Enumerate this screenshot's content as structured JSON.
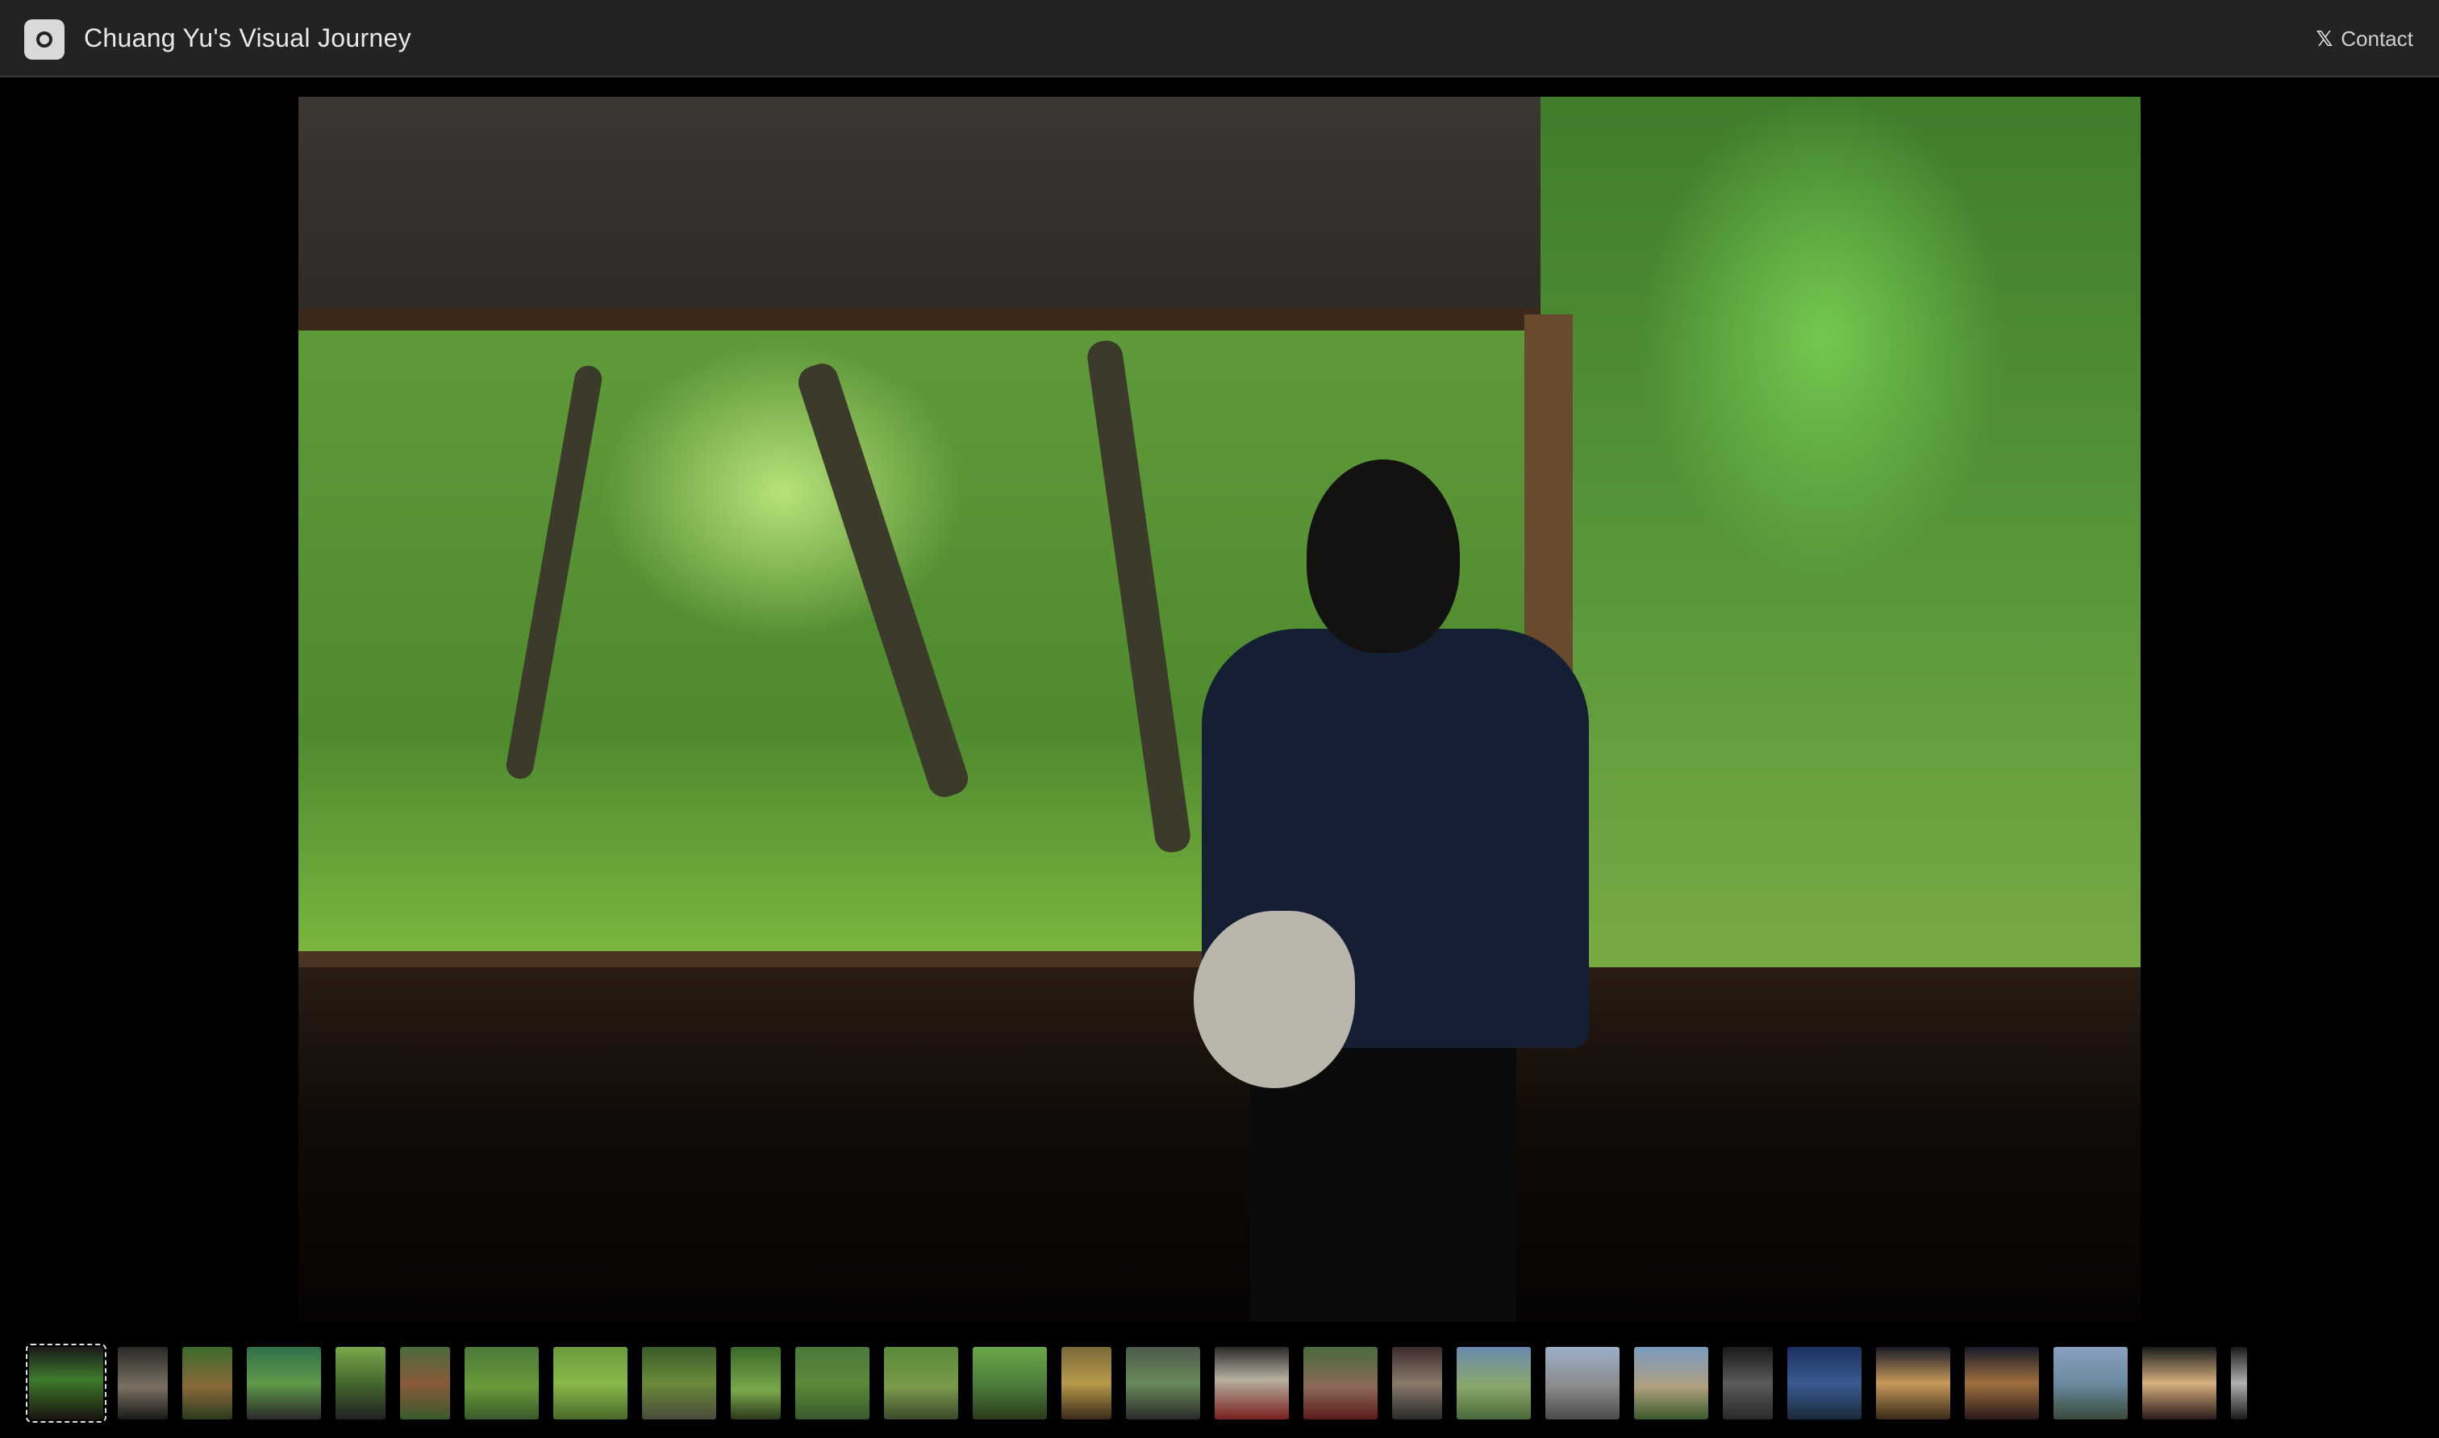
{
  "header": {
    "title": "Chuang Yu's Visual Journey",
    "contact_label": "Contact",
    "contact_icon": "x-logo-icon"
  },
  "viewer": {
    "photo_subject": "main-photo"
  },
  "filmstrip": {
    "active_index": 0,
    "thumbnails": [
      {
        "w": 92,
        "bg": "linear-gradient(180deg,#1a1a1a 0%,#3e7a2c 45%,#1a1410 100%)"
      },
      {
        "w": 62,
        "bg": "linear-gradient(180deg,#2a2a2a 0%,#7a7060 55%,#1a1a1a 100%)"
      },
      {
        "w": 62,
        "bg": "linear-gradient(180deg,#3c6a2a 0%,#8a6a3a 55%,#2a3a1c 100%)"
      },
      {
        "w": 92,
        "bg": "linear-gradient(180deg,#2f6f4a 0%,#5f9a4a 50%,#2a2a2a 100%)"
      },
      {
        "w": 62,
        "bg": "linear-gradient(180deg,#7aa84a 0%,#3c5a2a 60%,#222 100%)"
      },
      {
        "w": 62,
        "bg": "linear-gradient(180deg,#4a6a3a 0%,#8a5a3a 50%,#3a5a2a 100%)"
      },
      {
        "w": 92,
        "bg": "linear-gradient(180deg,#4a7a3a 0%,#6a9a3a 55%,#3a5a2a 100%)"
      },
      {
        "w": 92,
        "bg": "linear-gradient(180deg,#6a9a3a 0%,#8ab84a 50%,#4a6a2a 100%)"
      },
      {
        "w": 92,
        "bg": "linear-gradient(180deg,#3a5a2a 0%,#6a8a3a 50%,#4a4a3a 100%)"
      },
      {
        "w": 62,
        "bg": "linear-gradient(180deg,#3a6a2a 0%,#7aa84a 60%,#2a3a1c 100%)"
      },
      {
        "w": 92,
        "bg": "linear-gradient(180deg,#4a7a3a 0%,#5a8a3a 50%,#3a5a2a 100%)"
      },
      {
        "w": 92,
        "bg": "linear-gradient(180deg,#5a8a3a 0%,#7a9a4a 55%,#3a4a2a 100%)"
      },
      {
        "w": 92,
        "bg": "linear-gradient(180deg,#6aa84a 0%,#4a7a3a 55%,#2a3a1c 100%)"
      },
      {
        "w": 62,
        "bg": "linear-gradient(180deg,#7a6a3a 0%,#b89a4a 50%,#3a2a1a 100%)"
      },
      {
        "w": 92,
        "bg": "linear-gradient(180deg,#4a5a4a 0%,#6a8a5a 50%,#2a2a2a 100%)"
      },
      {
        "w": 92,
        "bg": "linear-gradient(180deg,#2a2a2a 0%,#b8b0a0 45%,#7a2020 100%)"
      },
      {
        "w": 92,
        "bg": "linear-gradient(180deg,#4a6a3a 0%,#8a6a5a 55%,#5a1a1a 100%)"
      },
      {
        "w": 62,
        "bg": "linear-gradient(180deg,#3a2a2a 0%,#8a7a6a 50%,#2a2a2a 100%)"
      },
      {
        "w": 92,
        "bg": "linear-gradient(180deg,#6a8ab0 0%,#8aa86a 55%,#4a6a3a 100%)"
      },
      {
        "w": 92,
        "bg": "linear-gradient(180deg,#9ab0c8 0%,#8a8a8a 55%,#4a4a4a 100%)"
      },
      {
        "w": 92,
        "bg": "linear-gradient(180deg,#7a9ac0 0%,#b0a080 55%,#3a5a2a 100%)"
      },
      {
        "w": 62,
        "bg": "linear-gradient(180deg,#1a1a1a 0%,#5a5a5a 50%,#2a2a2a 100%)"
      },
      {
        "w": 92,
        "bg": "linear-gradient(180deg,#1a3060 0%,#3a5a90 50%,#1a2a3a 100%)"
      },
      {
        "w": 92,
        "bg": "linear-gradient(180deg,#1a1a2a 0%,#c89a5a 50%,#3a2a1a 100%)"
      },
      {
        "w": 92,
        "bg": "linear-gradient(180deg,#1a1a2a 0%,#a07040 50%,#2a1a1a 100%)"
      },
      {
        "w": 92,
        "bg": "linear-gradient(180deg,#8aa0c0 0%,#6a8aa0 50%,#3a4a3a 100%)"
      },
      {
        "w": 92,
        "bg": "linear-gradient(180deg,#1a1a1a 0%,#d8b080 50%,#2a1a1a 100%)"
      },
      {
        "w": 20,
        "bg": "linear-gradient(180deg,#1a1a1a 0%,#b0b0b0 50%,#1a1a1a 100%)"
      }
    ]
  }
}
